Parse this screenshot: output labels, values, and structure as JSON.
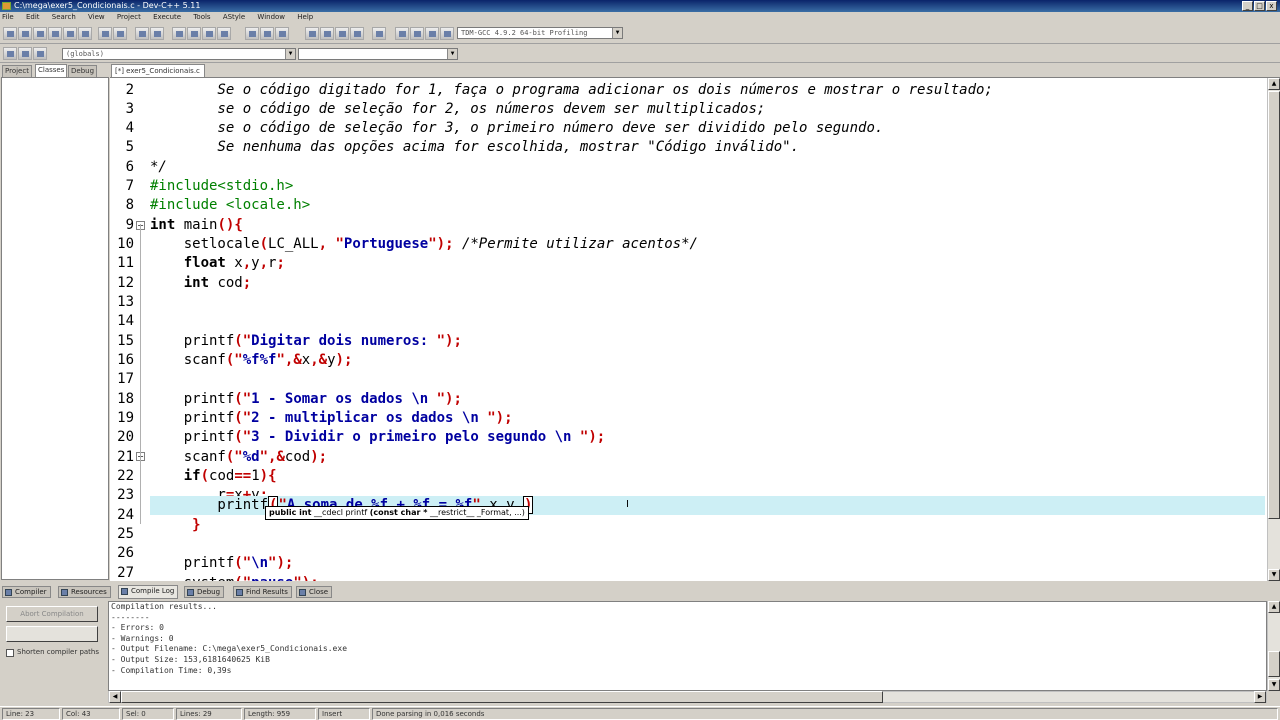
{
  "window": {
    "title": "C:\\mega\\exer5_Condicionais.c - Dev-C++ 5.11"
  },
  "menu": [
    "File",
    "Edit",
    "Search",
    "View",
    "Project",
    "Execute",
    "Tools",
    "AStyle",
    "Window",
    "Help"
  ],
  "toolbar": {
    "compiler_select": "TDM-GCC 4.9.2 64-bit Profiling",
    "globals_select": "(globals)"
  },
  "left_panel": {
    "tabs": [
      "Project",
      "Classes",
      "Debug"
    ]
  },
  "editor": {
    "file_tab": "[*] exer5_Condicionais.c",
    "lines": [
      {
        "n": "2",
        "t": "        Se o código digitado for 1, faça o programa adicionar os dois números e mostrar o resultado;"
      },
      {
        "n": "3",
        "t": "        se o código de seleção for 2, os números devem ser multiplicados;"
      },
      {
        "n": "4",
        "t": "        se o código de seleção for 3, o primeiro número deve ser dividido pelo segundo."
      },
      {
        "n": "5",
        "t": "        Se nenhuma das opções acima for escolhida, mostrar \"Código inválido\"."
      },
      {
        "n": "6",
        "t": "*/"
      },
      {
        "n": "7",
        "t": "#include<stdio.h>"
      },
      {
        "n": "8",
        "t": "#include <locale.h>"
      },
      {
        "n": "9",
        "t": "int main(){"
      },
      {
        "n": "10",
        "t": "    setlocale(LC_ALL, \"Portuguese\"); /*Permite utilizar acentos*/"
      },
      {
        "n": "11",
        "t": "    float x,y,r;"
      },
      {
        "n": "12",
        "t": "    int cod;"
      },
      {
        "n": "13",
        "t": ""
      },
      {
        "n": "14",
        "t": "    printf(\"Digitar dois numeros: \");"
      },
      {
        "n": "15",
        "t": "    scanf(\"%f%f\",&x,&y);"
      },
      {
        "n": "16",
        "t": ""
      },
      {
        "n": "17",
        "t": "    printf(\"1 - Somar os dados \\n \");"
      },
      {
        "n": "18",
        "t": "    printf(\"2 - multiplicar os dados \\n \");"
      },
      {
        "n": "19",
        "t": "    printf(\"3 - Dividir o primeiro pelo segundo \\n \");"
      },
      {
        "n": "20",
        "t": "    scanf(\"%d\",&cod);"
      },
      {
        "n": "21",
        "t": "    if(cod==1){"
      },
      {
        "n": "22",
        "t": "        r=x+y;"
      },
      {
        "n": "23",
        "t": "        printf(\"A soma de %f + %f = %f\",x,y,)"
      },
      {
        "n": "24",
        "t": "     }"
      },
      {
        "n": "25",
        "t": ""
      },
      {
        "n": "26",
        "t": "    printf(\"\\n\");"
      },
      {
        "n": "27",
        "t": "    system(\"pause\");"
      }
    ],
    "tooltip": {
      "bold_prefix": "public int",
      "text": " __cdecl printf ",
      "bold_args": "(const char *",
      "rest": " __restrict__ _Format, ...)"
    }
  },
  "bottom_tabs": [
    "Compiler",
    "Resources",
    "Compile Log",
    "Debug",
    "Find Results",
    "Close"
  ],
  "compile_panel": {
    "abort_button": "Abort Compilation",
    "shorten_checkbox": "Shorten compiler paths",
    "log": [
      "Compilation results...",
      "--------",
      "- Errors: 0",
      "- Warnings: 0",
      "- Output Filename: C:\\mega\\exer5_Condicionais.exe",
      "- Output Size: 153,6181640625 KiB",
      "- Compilation Time: 0,39s"
    ]
  },
  "status_bar": {
    "line": "Line: 23",
    "col": "Col: 43",
    "sel": "Sel: 0",
    "lines": "Lines: 29",
    "length": "Length: 959",
    "mode": "Insert",
    "parse": "Done parsing in 0,016 seconds"
  },
  "colors": {
    "active_line": "#cdeff5",
    "string": "#0000a0",
    "symbol": "#c00000",
    "preprocessor": "#008000"
  }
}
